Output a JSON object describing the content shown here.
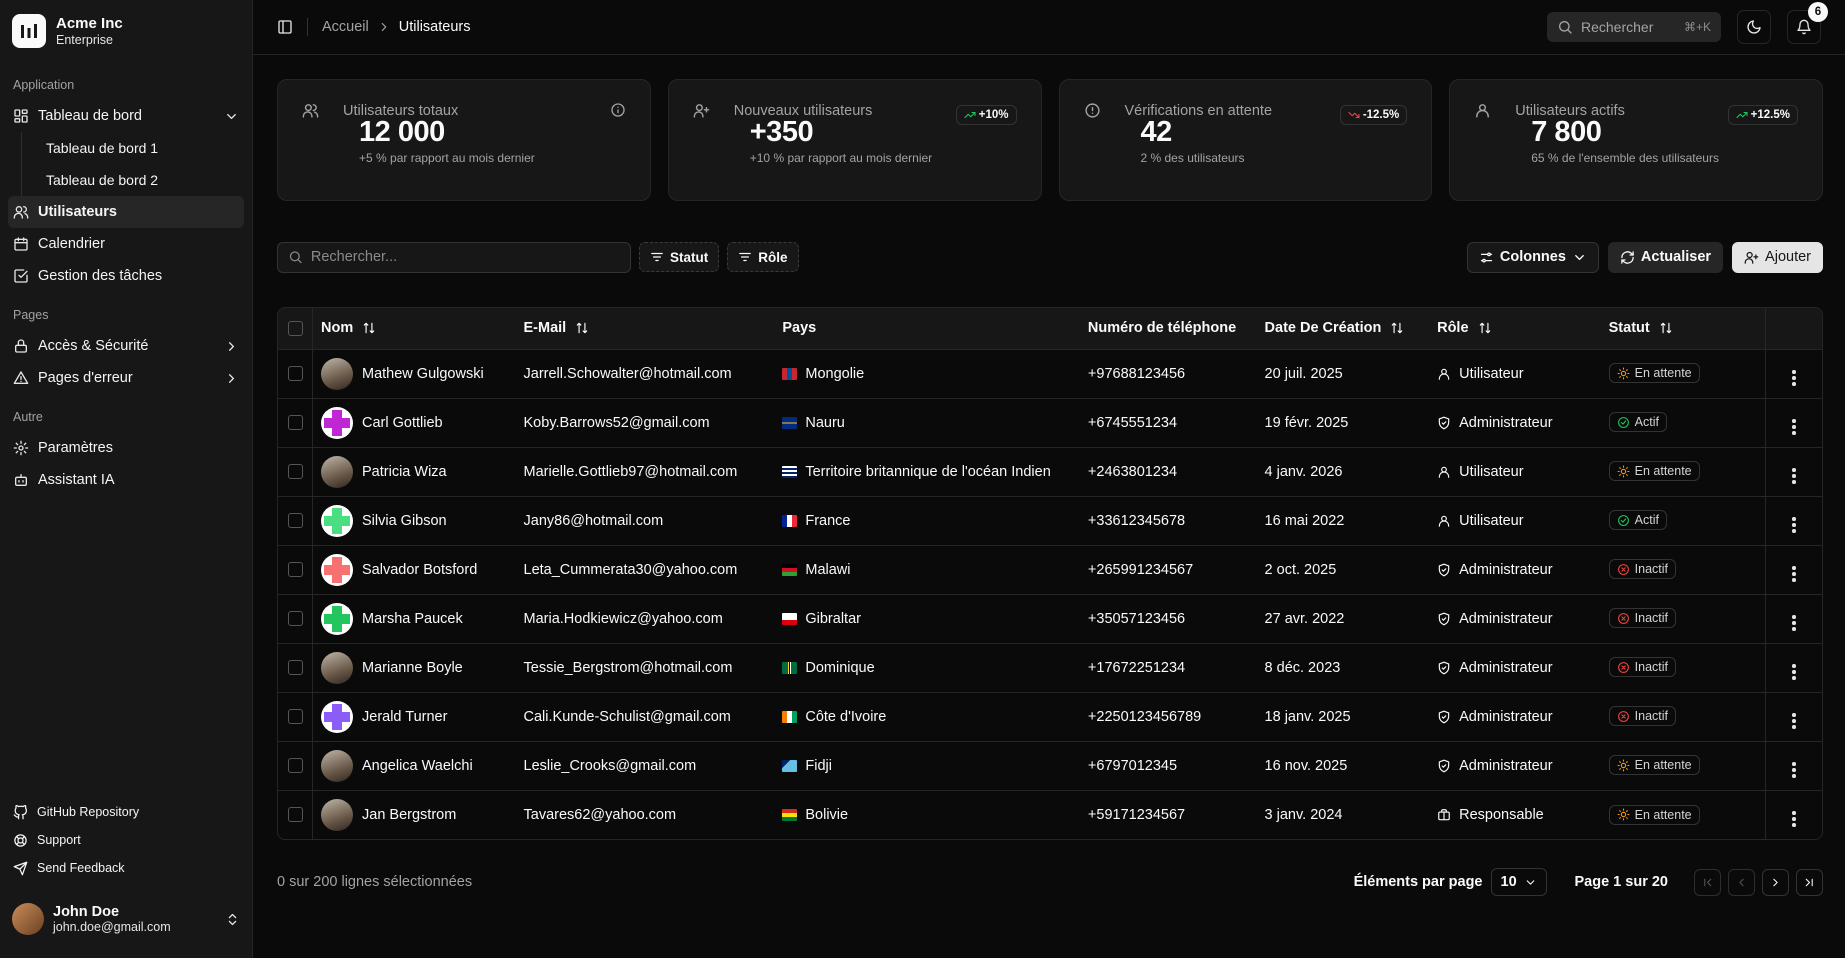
{
  "brand": {
    "name": "Acme Inc",
    "plan": "Enterprise"
  },
  "sidebar": {
    "groups": [
      {
        "label": "Application",
        "items": [
          {
            "label": "Tableau de bord",
            "icon": "layout-dashboard-icon",
            "expanded": true,
            "children": [
              "Tableau de bord 1",
              "Tableau de bord 2"
            ]
          },
          {
            "label": "Utilisateurs",
            "icon": "users-icon",
            "active": true
          },
          {
            "label": "Calendrier",
            "icon": "calendar-icon"
          },
          {
            "label": "Gestion des tâches",
            "icon": "square-check-icon"
          }
        ]
      },
      {
        "label": "Pages",
        "items": [
          {
            "label": "Accès & Sécurité",
            "icon": "lock-icon",
            "chevron": true
          },
          {
            "label": "Pages d'erreur",
            "icon": "alert-triangle-icon",
            "chevron": true
          }
        ]
      },
      {
        "label": "Autre",
        "items": [
          {
            "label": "Paramètres",
            "icon": "gear-icon"
          },
          {
            "label": "Assistant IA",
            "icon": "bot-icon"
          }
        ]
      }
    ],
    "footer": [
      {
        "label": "GitHub Repository",
        "icon": "github-icon"
      },
      {
        "label": "Support",
        "icon": "lifebuoy-icon"
      },
      {
        "label": "Send Feedback",
        "icon": "send-icon"
      }
    ],
    "user": {
      "name": "John Doe",
      "email": "john.doe@gmail.com"
    }
  },
  "topbar": {
    "breadcrumb": [
      "Accueil",
      "Utilisateurs"
    ],
    "search_label": "Rechercher",
    "search_kbd": "⌘+K",
    "notifications": "6"
  },
  "stats": [
    {
      "title": "Utilisateurs totaux",
      "value": "12 000",
      "desc": "+5 % par rapport au mois dernier",
      "icon": "users-icon",
      "extra": "info"
    },
    {
      "title": "Nouveaux utilisateurs",
      "value": "+350",
      "desc": "+10 % par rapport au mois dernier",
      "icon": "user-plus-icon",
      "trend": "+10%",
      "direction": "up"
    },
    {
      "title": "Vérifications en attente",
      "value": "42",
      "desc": "2 % des utilisateurs",
      "icon": "alert-circle-icon",
      "trend": "-12.5%",
      "direction": "down"
    },
    {
      "title": "Utilisateurs actifs",
      "value": "7 800",
      "desc": "65 % de l'ensemble des utilisateurs",
      "icon": "user-icon",
      "trend": "+12.5%",
      "direction": "up"
    }
  ],
  "toolbar": {
    "search_placeholder": "Rechercher...",
    "filter_status": "Statut",
    "filter_role": "Rôle",
    "columns": "Colonnes",
    "refresh": "Actualiser",
    "add": "Ajouter"
  },
  "table": {
    "headers": {
      "name": "Nom",
      "email": "E-Mail",
      "country": "Pays",
      "phone": "Numéro de téléphone",
      "created": "Date De Création",
      "role": "Rôle",
      "status": "Statut"
    },
    "rows": [
      {
        "name": "Mathew Gulgowski",
        "email": "Jarrell.Schowalter@hotmail.com",
        "country": "Mongolie",
        "phone": "+97688123456",
        "created": "20 juil. 2025",
        "role": "Utilisateur",
        "status": "En attente",
        "avatar": "photo",
        "flag": "mn"
      },
      {
        "name": "Carl Gottlieb",
        "email": "Koby.Barrows52@gmail.com",
        "country": "Nauru",
        "phone": "+6745551234",
        "created": "19 févr. 2025",
        "role": "Administrateur",
        "status": "Actif",
        "avatar": "#c026d3",
        "flag": "nr"
      },
      {
        "name": "Patricia Wiza",
        "email": "Marielle.Gottlieb97@hotmail.com",
        "country": "Territoire britannique de l'océan Indien",
        "phone": "+2463801234",
        "created": "4 janv. 2026",
        "role": "Utilisateur",
        "status": "En attente",
        "avatar": "photo",
        "flag": "io"
      },
      {
        "name": "Silvia Gibson",
        "email": "Jany86@hotmail.com",
        "country": "France",
        "phone": "+33612345678",
        "created": "16 mai 2022",
        "role": "Utilisateur",
        "status": "Actif",
        "avatar": "#4ade80",
        "flag": "fr"
      },
      {
        "name": "Salvador Botsford",
        "email": "Leta_Cummerata30@yahoo.com",
        "country": "Malawi",
        "phone": "+265991234567",
        "created": "2 oct. 2025",
        "role": "Administrateur",
        "status": "Inactif",
        "avatar": "#f87171",
        "flag": "mw"
      },
      {
        "name": "Marsha Paucek",
        "email": "Maria.Hodkiewicz@yahoo.com",
        "country": "Gibraltar",
        "phone": "+35057123456",
        "created": "27 avr. 2022",
        "role": "Administrateur",
        "status": "Inactif",
        "avatar": "#22c55e",
        "flag": "gi"
      },
      {
        "name": "Marianne Boyle",
        "email": "Tessie_Bergstrom@hotmail.com",
        "country": "Dominique",
        "phone": "+17672251234",
        "created": "8 déc. 2023",
        "role": "Administrateur",
        "status": "Inactif",
        "avatar": "photo",
        "flag": "dm"
      },
      {
        "name": "Jerald Turner",
        "email": "Cali.Kunde-Schulist@gmail.com",
        "country": "Côte d'Ivoire",
        "phone": "+2250123456789",
        "created": "18 janv. 2025",
        "role": "Administrateur",
        "status": "Inactif",
        "avatar": "#8b5cf6",
        "flag": "ci"
      },
      {
        "name": "Angelica Waelchi",
        "email": "Leslie_Crooks@gmail.com",
        "country": "Fidji",
        "phone": "+6797012345",
        "created": "16 nov. 2025",
        "role": "Administrateur",
        "status": "En attente",
        "avatar": "photo",
        "flag": "fj"
      },
      {
        "name": "Jan Bergstrom",
        "email": "Tavares62@yahoo.com",
        "country": "Bolivie",
        "phone": "+59171234567",
        "created": "3 janv. 2024",
        "role": "Responsable",
        "status": "En attente",
        "avatar": "photo",
        "flag": "bo"
      }
    ]
  },
  "pagination": {
    "selected": "0 sur 200 lignes sélectionnées",
    "per_page_label": "Éléments par page",
    "per_page": "10",
    "page": "Page 1 sur 20"
  }
}
